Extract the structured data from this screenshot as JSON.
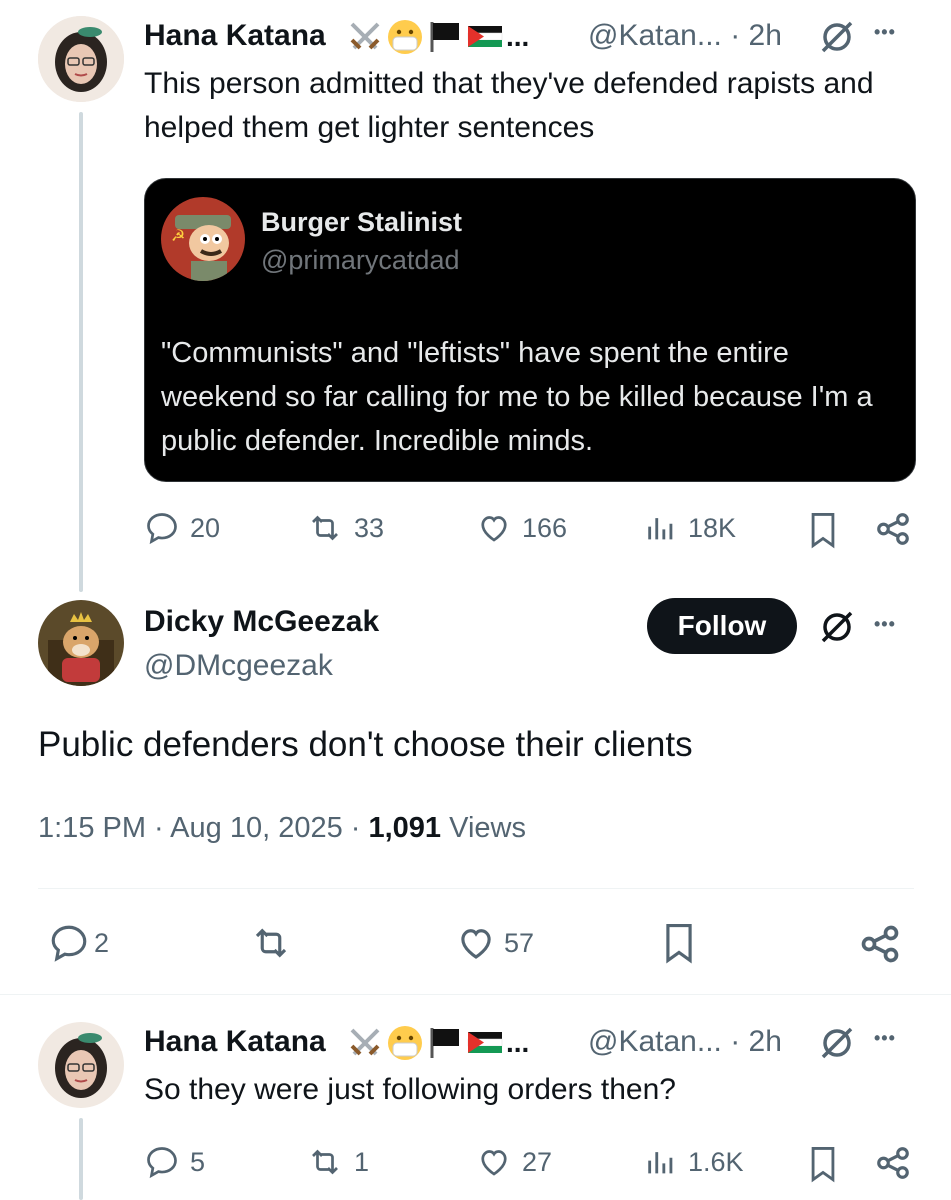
{
  "tweet1": {
    "author_name": "Hana Katana",
    "ellipsis": "...",
    "handle": "@Katan...",
    "separator": "·",
    "time": "2h",
    "more": "•••",
    "text": "This person admitted that they've defended rapists and helped them get lighter sentences",
    "quote": {
      "author_name": "Burger Stalinist",
      "handle": "@primarycatdad",
      "text": "\"Communists\" and \"leftists\" have spent the entire weekend so far calling for me to be killed because I'm a public defender. Incredible minds."
    },
    "actions": {
      "replies": "20",
      "reposts": "33",
      "likes": "166",
      "views": "18K"
    }
  },
  "tweet2": {
    "author_name": "Dicky McGeezak",
    "handle": "@DMcgeezak",
    "follow_label": "Follow",
    "more": "•••",
    "text": "Public defenders don't choose their clients",
    "timestamp": "1:15 PM · Aug 10, 2025 · ",
    "view_count": "1,091",
    "views_label": " Views",
    "actions": {
      "replies": "2",
      "likes": "57"
    }
  },
  "tweet3": {
    "author_name": "Hana Katana",
    "ellipsis": "...",
    "handle": "@Katan...",
    "separator": "·",
    "time": "2h",
    "more": "•••",
    "text": "So they were just following orders then?",
    "actions": {
      "replies": "5",
      "reposts": "1",
      "likes": "27",
      "views": "1.6K"
    }
  },
  "icons": [
    "crossed-swords-icon",
    "mask-face-icon",
    "black-flag-icon",
    "palestine-flag-icon",
    "grok-icon",
    "reply-icon",
    "repost-icon",
    "like-icon",
    "views-icon",
    "bookmark-icon",
    "share-icon"
  ],
  "colors": {
    "text": "#0f1419",
    "muted": "#536471",
    "quote_bg": "#000000",
    "follow_bg": "#0f1419",
    "thread_line": "#cfd9de"
  }
}
